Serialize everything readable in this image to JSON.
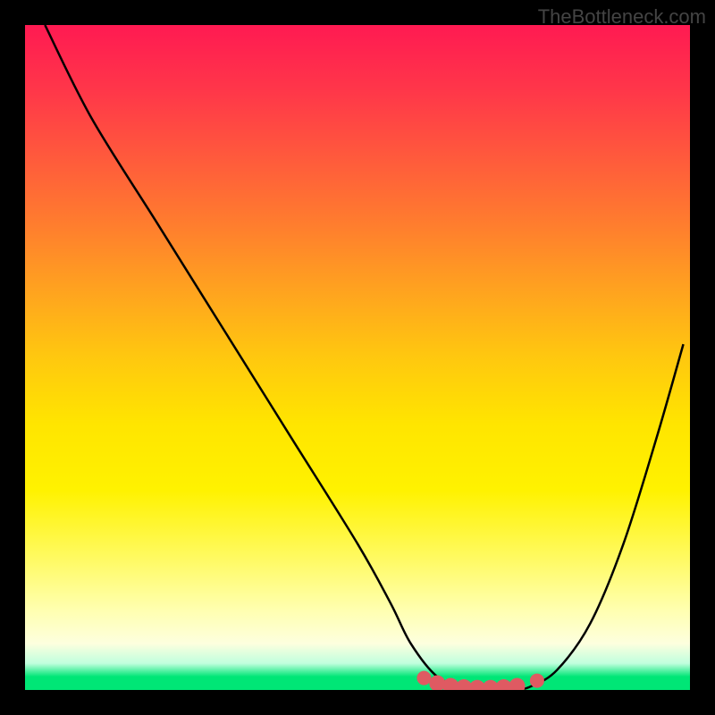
{
  "watermark": "TheBottleneck.com",
  "chart_data": {
    "type": "line",
    "title": "",
    "xlabel": "",
    "ylabel": "",
    "xlim": [
      0,
      100
    ],
    "ylim": [
      0,
      100
    ],
    "grid": false,
    "legend": false,
    "background": "red-yellow-green vertical gradient",
    "series": [
      {
        "name": "bottleneck-curve",
        "color": "#000000",
        "x": [
          3,
          10,
          20,
          30,
          40,
          50,
          55,
          58,
          62,
          66,
          70,
          74,
          76,
          80,
          85,
          90,
          95,
          99
        ],
        "y": [
          100,
          86,
          70,
          54,
          38,
          22,
          13,
          7,
          2,
          0.5,
          0.2,
          0.2,
          0.5,
          3,
          10,
          22,
          38,
          52
        ]
      }
    ],
    "markers": {
      "name": "bottom-cluster",
      "color": "#df5a62",
      "points": [
        {
          "x": 60,
          "y": 1.8
        },
        {
          "x": 62,
          "y": 1.0
        },
        {
          "x": 64,
          "y": 0.6
        },
        {
          "x": 66,
          "y": 0.4
        },
        {
          "x": 68,
          "y": 0.3
        },
        {
          "x": 70,
          "y": 0.3
        },
        {
          "x": 72,
          "y": 0.4
        },
        {
          "x": 74,
          "y": 0.6
        },
        {
          "x": 77,
          "y": 1.4
        }
      ]
    }
  }
}
